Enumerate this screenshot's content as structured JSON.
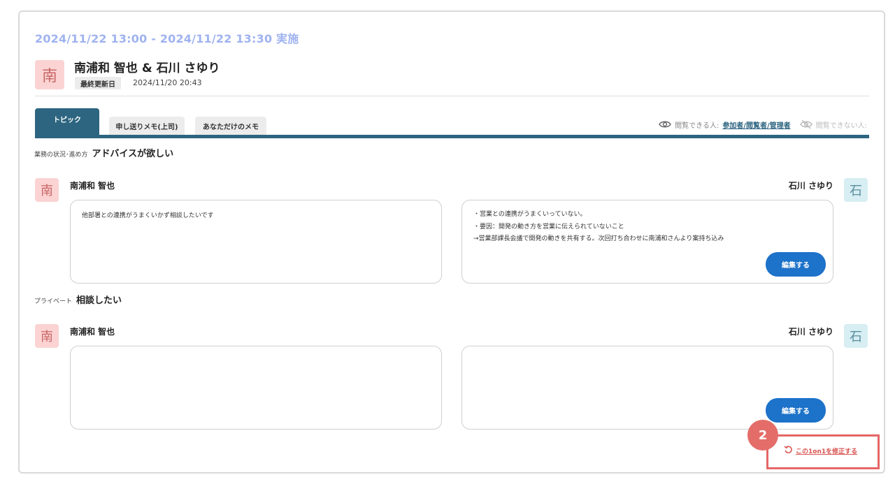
{
  "meeting": {
    "datetime": "2024/11/22 13:00 - 2024/11/22 13:30 実施",
    "avatar": "南",
    "participants": "南浦和 智也 & 石川 さゆり",
    "updated_label": "最終更新日",
    "updated_value": "2024/11/20 20:43"
  },
  "tabs": [
    {
      "label": "トピック",
      "active": true
    },
    {
      "label": "申し送りメモ(上司)",
      "active": false
    },
    {
      "label": "あなただけのメモ",
      "active": false
    }
  ],
  "visibility": {
    "visible_label": "閲覧できる人:",
    "visible_value": "参加者/閲覧者/管理者",
    "hidden_label": "閲覧できない人:",
    "icons": [
      "eye-icon",
      "eye-off-icon"
    ]
  },
  "topics": [
    {
      "category": "業務の状況･進め方",
      "title": "アドバイスが欲しい",
      "left_person": {
        "avatar": "南",
        "name": "南浦和 智也"
      },
      "right_person": {
        "avatar": "石",
        "name": "石川 さゆり"
      },
      "left_note": "他部署との連携がうまくいかず相談したいです",
      "right_note": "・営業との連携がうまくいっていない。\n・要因：開発の動き方を営業に伝えられていないこと\n→営業部課長会議で開発の動きを共有する。次回打ち合わせに南浦和さんより案持ち込み",
      "edit_label": "編集する"
    },
    {
      "category": "プライベート",
      "title": "相談したい",
      "left_person": {
        "avatar": "南",
        "name": "南浦和 智也"
      },
      "right_person": {
        "avatar": "石",
        "name": "石川 さゆり"
      },
      "left_note": "",
      "right_note": "",
      "edit_label": "編集する"
    }
  ],
  "footer": {
    "revise_label": "この1on1を修正する",
    "step_number": "2"
  },
  "colors": {
    "tab_active": "#2d6580",
    "button": "#1d72c9",
    "date": "#9fb3f0",
    "highlight": "#e66666"
  }
}
